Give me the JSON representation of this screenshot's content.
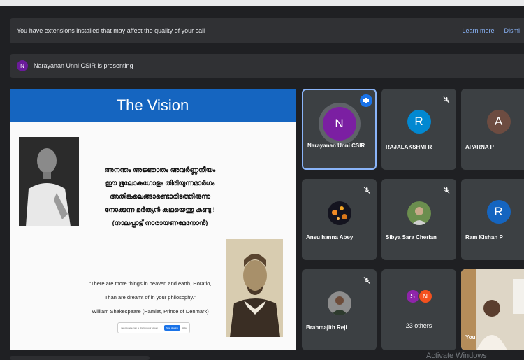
{
  "banner": {
    "message": "You have extensions installed that may affect the quality of your call",
    "learn_more": "Learn more",
    "dismiss": "Dismi"
  },
  "presenting": {
    "avatar_letter": "N",
    "text": "Narayanan Unni CSIR is presenting"
  },
  "slide": {
    "title": "The Vision",
    "malayalam_lines": [
      "അനന്തം അജ്ഞാതം അവർണ്ണനീയം",
      "ഈ ഭൂലോകഗോളം തിരിയുന്നമാർഗം",
      "അതിങ്കലെങ്ങാണ്ടൊരിടത്തിരുന്നു",
      "നോക്കുന്ന മർത്യൻ കഥയെന്തു കണ്ടു !",
      "(നാലപ്പാട്ട് നാരായണമേനോൻ)"
    ],
    "quote_line1": "“There are more things in heaven and earth, Horatio,",
    "quote_line2": "Than are dreamt of in your philosophy.”",
    "quote_attr": "William Shakespeare (Hamlet, Prince of Denmark)",
    "share_text": "meet.google.com is sharing your screen",
    "stop_sharing": "Stop sharing",
    "hide": "Hide"
  },
  "participants": [
    {
      "name": "Narayanan Unni CSIR",
      "letter": "N",
      "color": "#7b1fa2",
      "state": "speaking"
    },
    {
      "name": "RAJALAKSHMI R",
      "letter": "R",
      "color": "#0288d1",
      "state": "muted"
    },
    {
      "name": "APARNA P",
      "letter": "A",
      "color": "#6d4c41",
      "state": ""
    },
    {
      "name": "Ansu hanna Abey",
      "letter": "",
      "color": "#1a1a2e",
      "state": "muted"
    },
    {
      "name": "Sibya Sara Cherian",
      "letter": "",
      "color": "#6b8e4e",
      "state": "muted"
    },
    {
      "name": "Ram Kishan P",
      "letter": "R",
      "color": "#1565c0",
      "state": ""
    },
    {
      "name": "Brahmajith Reji",
      "letter": "",
      "color": "#8d8d8d",
      "state": "muted"
    },
    {
      "name": "",
      "letter": "",
      "color": "",
      "state": ""
    },
    {
      "name": "You",
      "letter": "",
      "color": "#e8e4dc",
      "state": ""
    }
  ],
  "others": {
    "label": "23 others",
    "a": {
      "letter": "S",
      "color": "#8e24aa"
    },
    "b": {
      "letter": "N",
      "color": "#f4511e"
    }
  },
  "watermark": "Activate Windows"
}
